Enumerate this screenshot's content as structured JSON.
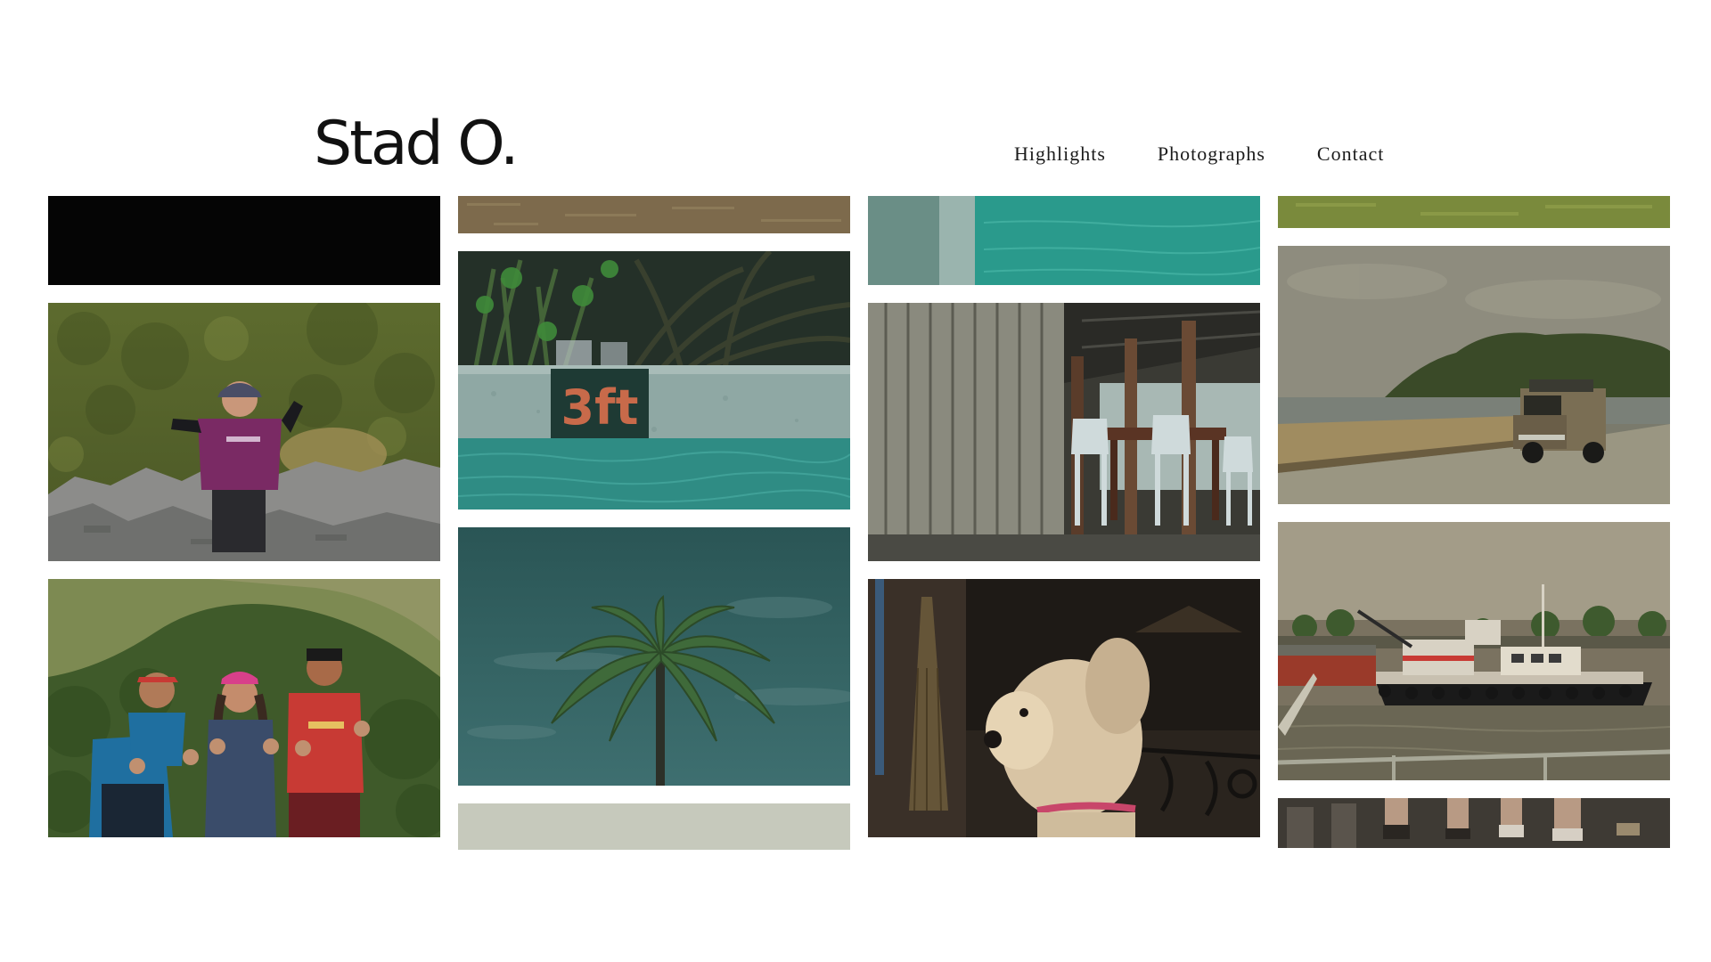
{
  "brand": {
    "logo_text": "Stad O."
  },
  "nav": {
    "items": [
      {
        "label": "Highlights"
      },
      {
        "label": "Photographs"
      },
      {
        "label": "Contact"
      }
    ]
  },
  "gallery": {
    "columns": [
      {
        "tiles": [
          "dark-photo",
          "hiker-purple-shirt-on-rocks",
          "three-hikers-thumbs-up"
        ]
      },
      {
        "tiles": [
          "dry-grass-strip",
          "pool-wall-3ft-sign",
          "palm-tree-sky",
          "pale-sky-strip"
        ]
      },
      {
        "tiles": [
          "pool-water-edge",
          "poolside-tables-chairs",
          "white-dog-porch"
        ]
      },
      {
        "tiles": [
          "green-grass-strip",
          "coastal-road-jeep",
          "tugboat-harbor",
          "people-walking-strip"
        ]
      }
    ],
    "sign_text": "3ft",
    "colors": {
      "teal": "#2f8c84",
      "olive": "#6e7840",
      "purple_shirt": "#7a2a64",
      "red_shirt": "#c83a34",
      "blue_jacket": "#1f6fa0"
    }
  }
}
